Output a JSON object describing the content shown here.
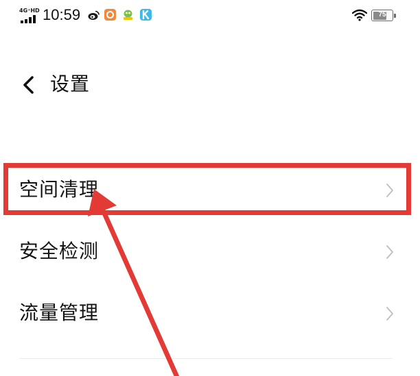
{
  "status_bar": {
    "network_label": "4G⁺HD",
    "time": "10:59",
    "battery_level": "75",
    "battery_fraction": 0.75,
    "icons": [
      "signal-bars-icon",
      "weibo-icon",
      "orange-app-icon",
      "green-app-icon",
      "kuaishou-icon",
      "wifi-icon",
      "battery-icon"
    ]
  },
  "header": {
    "back_icon": "chevron-left-icon",
    "title": "设置"
  },
  "menu": {
    "items": [
      {
        "label": "空间清理",
        "icon": "chevron-right-icon",
        "highlighted": true
      },
      {
        "label": "安全检测",
        "icon": "chevron-right-icon"
      },
      {
        "label": "流量管理",
        "icon": "chevron-right-icon"
      }
    ]
  },
  "annotation": {
    "color": "#e43a35",
    "shapes": [
      "highlight-box",
      "pointer-arrow"
    ]
  }
}
